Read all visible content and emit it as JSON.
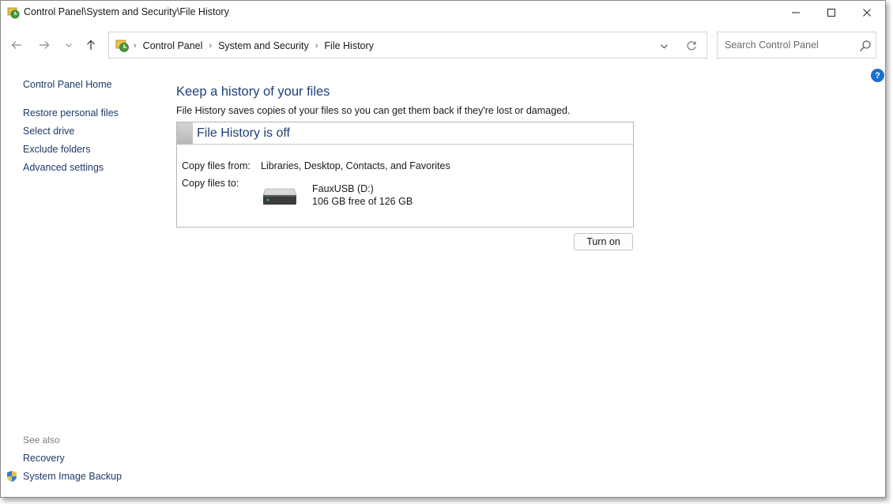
{
  "window": {
    "title": "Control Panel\\System and Security\\File History",
    "app_icon": "control-panel-icon"
  },
  "nav": {
    "breadcrumbs": [
      "Control Panel",
      "System and Security",
      "File History"
    ],
    "search_placeholder": "Search Control Panel"
  },
  "sidebar": {
    "home": "Control Panel Home",
    "links": [
      "Restore personal files",
      "Select drive",
      "Exclude folders",
      "Advanced settings"
    ],
    "see_also_label": "See also",
    "see_also": [
      "Recovery",
      "System Image Backup"
    ]
  },
  "main": {
    "title": "Keep a history of your files",
    "description": "File History saves copies of your files so you can get them back if they're lost or damaged.",
    "status": "File History is off",
    "copy_from_label": "Copy files from:",
    "copy_from_value": "Libraries, Desktop, Contacts, and Favorites",
    "copy_to_label": "Copy files to:",
    "drive_name": "FauxUSB (D:)",
    "drive_space": "106 GB free of 126 GB",
    "turn_on_label": "Turn on"
  },
  "help": {
    "glyph": "?"
  },
  "colors": {
    "link": "#1d3a6b",
    "heading": "#1d3f7a",
    "help_badge": "#1b6fd1"
  }
}
